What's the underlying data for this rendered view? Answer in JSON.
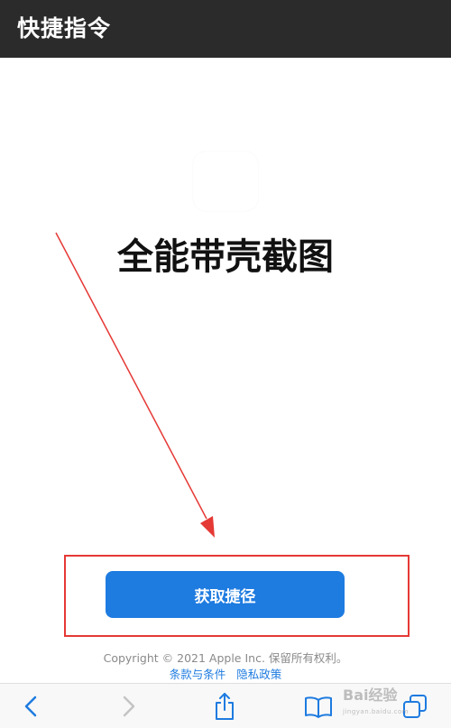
{
  "header": {
    "title": "快捷指令"
  },
  "shortcut": {
    "name": "全能带壳截图",
    "get_button_label": "获取捷径"
  },
  "footer": {
    "copyright": "Copyright © 2021 Apple Inc. 保留所有权利。",
    "terms_link": "条款与条件",
    "privacy_link": "隐私政策"
  },
  "annotation": {
    "color": "#e53935"
  },
  "toolbar": {
    "icons": [
      "back-icon",
      "forward-icon",
      "share-icon",
      "bookmarks-icon",
      "tabs-icon"
    ]
  },
  "colors": {
    "accent": "#1e7be0",
    "header_bg": "#2b2b2b"
  }
}
